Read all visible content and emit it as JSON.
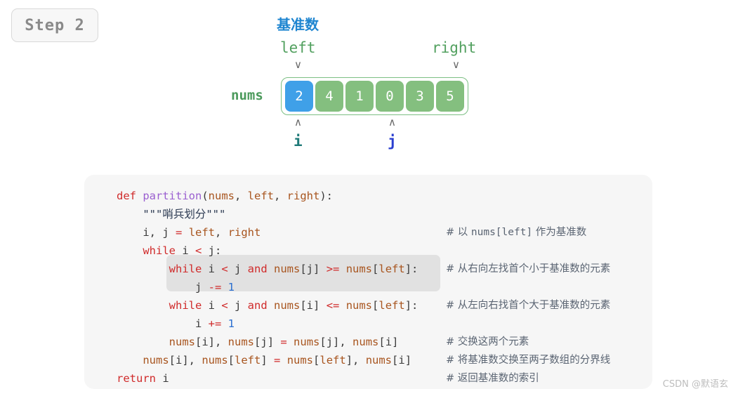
{
  "step_badge": {
    "label": "Step 2"
  },
  "diagram": {
    "pivot_label": "基准数",
    "left_label": "left",
    "right_label": "right",
    "nums_label": "nums",
    "i_label": "i",
    "j_label": "j",
    "caret_down": "∨",
    "caret_up": "∧",
    "cells": [
      {
        "value": "2",
        "highlight": "pivot"
      },
      {
        "value": "4",
        "highlight": "normal"
      },
      {
        "value": "1",
        "highlight": "normal"
      },
      {
        "value": "0",
        "highlight": "normal"
      },
      {
        "value": "3",
        "highlight": "normal"
      },
      {
        "value": "5",
        "highlight": "normal"
      }
    ],
    "colors": {
      "pivot_cell": "#3fa0e8",
      "normal_cell": "#84bf7f",
      "box_border": "#7cbf84",
      "pivot_text": "#1e85d0",
      "pointer_text": "#52a05f",
      "nums_text": "#4c9a5c",
      "i_text": "#1f7a78",
      "j_text": "#2b3fd0"
    }
  },
  "code": {
    "lines": [
      {
        "indent": "",
        "tokens": [
          {
            "t": "def ",
            "c": "kw"
          },
          {
            "t": "partition",
            "c": "fn"
          },
          {
            "t": "(",
            "c": "punc"
          },
          {
            "t": "nums",
            "c": "name"
          },
          {
            "t": ", ",
            "c": "punc"
          },
          {
            "t": "left",
            "c": "name"
          },
          {
            "t": ", ",
            "c": "punc"
          },
          {
            "t": "right",
            "c": "name"
          },
          {
            "t": "):",
            "c": "punc"
          }
        ],
        "comment": ""
      },
      {
        "indent": "    ",
        "tokens": [
          {
            "t": "\"\"\"哨兵划分\"\"\"",
            "c": "str"
          }
        ],
        "comment": ""
      },
      {
        "indent": "    ",
        "tokens": [
          {
            "t": "i",
            "c": "plain"
          },
          {
            "t": ", ",
            "c": "punc"
          },
          {
            "t": "j ",
            "c": "plain"
          },
          {
            "t": "= ",
            "c": "op"
          },
          {
            "t": "left",
            "c": "name"
          },
          {
            "t": ", ",
            "c": "punc"
          },
          {
            "t": "right",
            "c": "name"
          }
        ],
        "comment": "# 以 nums[left] 作为基准数",
        "comment_mono": "nums[left]"
      },
      {
        "indent": "    ",
        "tokens": [
          {
            "t": "while ",
            "c": "kw"
          },
          {
            "t": "i ",
            "c": "plain"
          },
          {
            "t": "< ",
            "c": "op"
          },
          {
            "t": "j",
            "c": "plain"
          },
          {
            "t": ":",
            "c": "punc"
          }
        ],
        "comment": ""
      },
      {
        "indent": "        ",
        "tokens": [
          {
            "t": "while ",
            "c": "kw"
          },
          {
            "t": "i ",
            "c": "plain"
          },
          {
            "t": "< ",
            "c": "op"
          },
          {
            "t": "j ",
            "c": "plain"
          },
          {
            "t": "and ",
            "c": "kw"
          },
          {
            "t": "nums",
            "c": "name"
          },
          {
            "t": "[",
            "c": "punc"
          },
          {
            "t": "j",
            "c": "plain"
          },
          {
            "t": "] ",
            "c": "punc"
          },
          {
            "t": ">= ",
            "c": "op"
          },
          {
            "t": "nums",
            "c": "name"
          },
          {
            "t": "[",
            "c": "punc"
          },
          {
            "t": "left",
            "c": "name"
          },
          {
            "t": "]:",
            "c": "punc"
          }
        ],
        "comment": "# 从右向左找首个小于基准数的元素"
      },
      {
        "indent": "            ",
        "tokens": [
          {
            "t": "j ",
            "c": "plain"
          },
          {
            "t": "-= ",
            "c": "op"
          },
          {
            "t": "1",
            "c": "num"
          }
        ],
        "comment": ""
      },
      {
        "indent": "        ",
        "tokens": [
          {
            "t": "while ",
            "c": "kw"
          },
          {
            "t": "i ",
            "c": "plain"
          },
          {
            "t": "< ",
            "c": "op"
          },
          {
            "t": "j ",
            "c": "plain"
          },
          {
            "t": "and ",
            "c": "kw"
          },
          {
            "t": "nums",
            "c": "name"
          },
          {
            "t": "[",
            "c": "punc"
          },
          {
            "t": "i",
            "c": "plain"
          },
          {
            "t": "] ",
            "c": "punc"
          },
          {
            "t": "<= ",
            "c": "op"
          },
          {
            "t": "nums",
            "c": "name"
          },
          {
            "t": "[",
            "c": "punc"
          },
          {
            "t": "left",
            "c": "name"
          },
          {
            "t": "]:",
            "c": "punc"
          }
        ],
        "comment": "# 从左向右找首个大于基准数的元素"
      },
      {
        "indent": "            ",
        "tokens": [
          {
            "t": "i ",
            "c": "plain"
          },
          {
            "t": "+= ",
            "c": "op"
          },
          {
            "t": "1",
            "c": "num"
          }
        ],
        "comment": ""
      },
      {
        "indent": "        ",
        "tokens": [
          {
            "t": "nums",
            "c": "name"
          },
          {
            "t": "[",
            "c": "punc"
          },
          {
            "t": "i",
            "c": "plain"
          },
          {
            "t": "], ",
            "c": "punc"
          },
          {
            "t": "nums",
            "c": "name"
          },
          {
            "t": "[",
            "c": "punc"
          },
          {
            "t": "j",
            "c": "plain"
          },
          {
            "t": "] ",
            "c": "punc"
          },
          {
            "t": "= ",
            "c": "op"
          },
          {
            "t": "nums",
            "c": "name"
          },
          {
            "t": "[",
            "c": "punc"
          },
          {
            "t": "j",
            "c": "plain"
          },
          {
            "t": "], ",
            "c": "punc"
          },
          {
            "t": "nums",
            "c": "name"
          },
          {
            "t": "[",
            "c": "punc"
          },
          {
            "t": "i",
            "c": "plain"
          },
          {
            "t": "]",
            "c": "punc"
          }
        ],
        "comment": "# 交换这两个元素"
      },
      {
        "indent": "    ",
        "tokens": [
          {
            "t": "nums",
            "c": "name"
          },
          {
            "t": "[",
            "c": "punc"
          },
          {
            "t": "i",
            "c": "plain"
          },
          {
            "t": "], ",
            "c": "punc"
          },
          {
            "t": "nums",
            "c": "name"
          },
          {
            "t": "[",
            "c": "punc"
          },
          {
            "t": "left",
            "c": "name"
          },
          {
            "t": "] ",
            "c": "punc"
          },
          {
            "t": "= ",
            "c": "op"
          },
          {
            "t": "nums",
            "c": "name"
          },
          {
            "t": "[",
            "c": "punc"
          },
          {
            "t": "left",
            "c": "name"
          },
          {
            "t": "], ",
            "c": "punc"
          },
          {
            "t": "nums",
            "c": "name"
          },
          {
            "t": "[",
            "c": "punc"
          },
          {
            "t": "i",
            "c": "plain"
          },
          {
            "t": "]",
            "c": "punc"
          }
        ],
        "comment": "# 将基准数交换至两子数组的分界线"
      },
      {
        "indent": "",
        "tokens": [
          {
            "t": "return ",
            "c": "kw"
          },
          {
            "t": "i",
            "c": "plain"
          }
        ],
        "comment": "# 返回基准数的索引"
      }
    ]
  },
  "watermark": {
    "text": "CSDN @默语玄"
  }
}
